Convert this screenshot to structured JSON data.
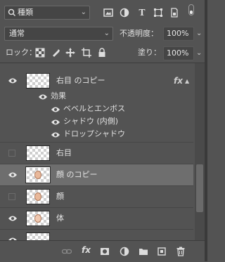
{
  "filter": {
    "label": "種類"
  },
  "blend": {
    "mode": "通常",
    "opacity_label": "不透明度：",
    "opacity": "100%"
  },
  "lock": {
    "label": "ロック：",
    "fill_label": "塗り：",
    "fill": "100%"
  },
  "layers": [
    {
      "name": "右目 のコピー",
      "visible": true,
      "fx": "fx"
    },
    {
      "name": "右目",
      "visible": false
    },
    {
      "name": "顔 のコピー",
      "visible": true,
      "selected": true
    },
    {
      "name": "顔",
      "visible": false
    },
    {
      "name": "体",
      "visible": true
    }
  ],
  "effects": {
    "header": "効果",
    "items": [
      "ベベルとエンボス",
      "シャドウ (内側)",
      "ドロップシャドウ"
    ]
  },
  "colors": {
    "panel": "#535353",
    "selected": "#6e6e6e",
    "field": "#454545"
  },
  "icons": [
    "search-icon",
    "image-filter-icon",
    "adjustment-filter-icon",
    "type-filter-icon",
    "shape-filter-icon",
    "smartobject-filter-icon",
    "eye-icon",
    "link-icon",
    "fx-icon",
    "mask-icon",
    "adjustment-icon",
    "folder-icon",
    "new-layer-icon",
    "trash-icon"
  ]
}
